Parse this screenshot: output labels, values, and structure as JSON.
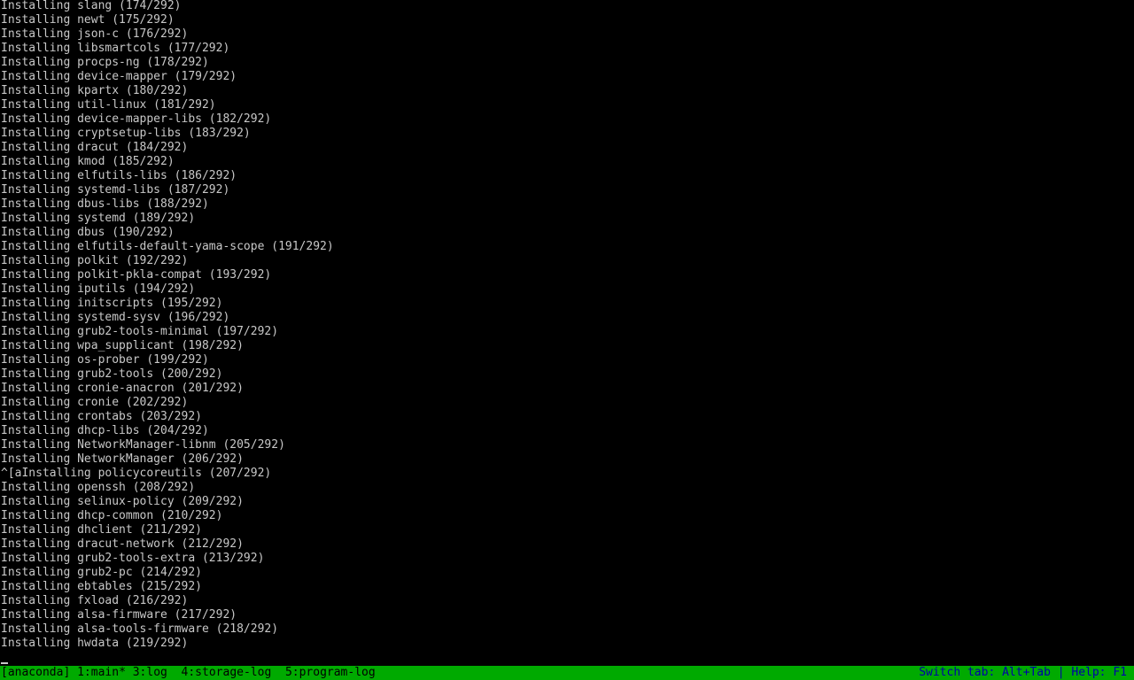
{
  "log": {
    "lines": [
      "Installing slang (174/292)",
      "Installing newt (175/292)",
      "Installing json-c (176/292)",
      "Installing libsmartcols (177/292)",
      "Installing procps-ng (178/292)",
      "Installing device-mapper (179/292)",
      "Installing kpartx (180/292)",
      "Installing util-linux (181/292)",
      "Installing device-mapper-libs (182/292)",
      "Installing cryptsetup-libs (183/292)",
      "Installing dracut (184/292)",
      "Installing kmod (185/292)",
      "Installing elfutils-libs (186/292)",
      "Installing systemd-libs (187/292)",
      "Installing dbus-libs (188/292)",
      "Installing systemd (189/292)",
      "Installing dbus (190/292)",
      "Installing elfutils-default-yama-scope (191/292)",
      "Installing polkit (192/292)",
      "Installing polkit-pkla-compat (193/292)",
      "Installing iputils (194/292)",
      "Installing initscripts (195/292)",
      "Installing systemd-sysv (196/292)",
      "Installing grub2-tools-minimal (197/292)",
      "Installing wpa_supplicant (198/292)",
      "Installing os-prober (199/292)",
      "Installing grub2-tools (200/292)",
      "Installing cronie-anacron (201/292)",
      "Installing cronie (202/292)",
      "Installing crontabs (203/292)",
      "Installing dhcp-libs (204/292)",
      "Installing NetworkManager-libnm (205/292)",
      "Installing NetworkManager (206/292)",
      "^[aInstalling policycoreutils (207/292)",
      "Installing openssh (208/292)",
      "Installing selinux-policy (209/292)",
      "Installing dhcp-common (210/292)",
      "Installing dhclient (211/292)",
      "Installing dracut-network (212/292)",
      "Installing grub2-tools-extra (213/292)",
      "Installing grub2-pc (214/292)",
      "Installing ebtables (215/292)",
      "Installing fxload (216/292)",
      "Installing alsa-firmware (217/292)",
      "Installing alsa-tools-firmware (218/292)",
      "Installing hwdata (219/292)"
    ]
  },
  "status_bar": {
    "session": "[anaconda]",
    "tabs": [
      "1:main*",
      "3:log",
      "4:storage-log",
      "5:program-log"
    ],
    "help_text": "Switch tab: Alt+Tab | Help: F1"
  },
  "colors": {
    "background": "#000000",
    "text": "#c8c8c8",
    "status_bar_bg": "#00aa00",
    "status_bar_text": "#000000",
    "help_text": "#0000aa"
  }
}
